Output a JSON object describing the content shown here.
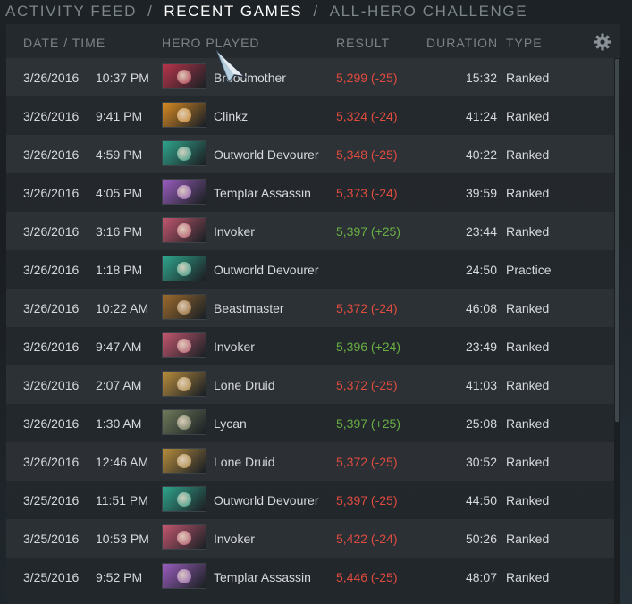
{
  "tabs": [
    {
      "label": "ACTIVITY FEED",
      "active": false
    },
    {
      "label": "RECENT GAMES",
      "active": true
    },
    {
      "label": "ALL-HERO CHALLENGE",
      "active": false
    }
  ],
  "tab_separator": "/",
  "columns": {
    "date_time": "DATE / TIME",
    "hero": "HERO PLAYED",
    "result": "RESULT",
    "duration": "DURATION",
    "type": "TYPE"
  },
  "settings_icon": "gear-icon",
  "colors": {
    "loss": "#e04b3f",
    "win": "#69b043",
    "text": "#d7dadc",
    "header": "#7c8387"
  },
  "games": [
    {
      "date": "3/26/2016",
      "time": "10:37 PM",
      "hero": "Broodmother",
      "hero_color": "#b8344b",
      "result": "5,299 (-25)",
      "outcome": "loss",
      "duration": "15:32",
      "type": "Ranked"
    },
    {
      "date": "3/26/2016",
      "time": "9:41 PM",
      "hero": "Clinkz",
      "hero_color": "#d88a22",
      "result": "5,324 (-24)",
      "outcome": "loss",
      "duration": "41:24",
      "type": "Ranked"
    },
    {
      "date": "3/26/2016",
      "time": "4:59 PM",
      "hero": "Outworld Devourer",
      "hero_color": "#2fa58c",
      "result": "5,348 (-25)",
      "outcome": "loss",
      "duration": "40:22",
      "type": "Ranked"
    },
    {
      "date": "3/26/2016",
      "time": "4:05 PM",
      "hero": "Templar Assassin",
      "hero_color": "#9a5dbf",
      "result": "5,373 (-24)",
      "outcome": "loss",
      "duration": "39:59",
      "type": "Ranked"
    },
    {
      "date": "3/26/2016",
      "time": "3:16 PM",
      "hero": "Invoker",
      "hero_color": "#c2566e",
      "result": "5,397 (+25)",
      "outcome": "win",
      "duration": "23:44",
      "type": "Ranked"
    },
    {
      "date": "3/26/2016",
      "time": "1:18 PM",
      "hero": "Outworld Devourer",
      "hero_color": "#2fa58c",
      "result": "",
      "outcome": "none",
      "duration": "24:50",
      "type": "Practice"
    },
    {
      "date": "3/26/2016",
      "time": "10:22 AM",
      "hero": "Beastmaster",
      "hero_color": "#9c6a2c",
      "result": "5,372 (-24)",
      "outcome": "loss",
      "duration": "46:08",
      "type": "Ranked"
    },
    {
      "date": "3/26/2016",
      "time": "9:47 AM",
      "hero": "Invoker",
      "hero_color": "#c2566e",
      "result": "5,396 (+24)",
      "outcome": "win",
      "duration": "23:49",
      "type": "Ranked"
    },
    {
      "date": "3/26/2016",
      "time": "2:07 AM",
      "hero": "Lone Druid",
      "hero_color": "#b88d3c",
      "result": "5,372 (-25)",
      "outcome": "loss",
      "duration": "41:03",
      "type": "Ranked"
    },
    {
      "date": "3/26/2016",
      "time": "1:30 AM",
      "hero": "Lycan",
      "hero_color": "#6e7a5a",
      "result": "5,397 (+25)",
      "outcome": "win",
      "duration": "25:08",
      "type": "Ranked"
    },
    {
      "date": "3/26/2016",
      "time": "12:46 AM",
      "hero": "Lone Druid",
      "hero_color": "#b88d3c",
      "result": "5,372 (-25)",
      "outcome": "loss",
      "duration": "30:52",
      "type": "Ranked"
    },
    {
      "date": "3/25/2016",
      "time": "11:51 PM",
      "hero": "Outworld Devourer",
      "hero_color": "#2fa58c",
      "result": "5,397 (-25)",
      "outcome": "loss",
      "duration": "44:50",
      "type": "Ranked"
    },
    {
      "date": "3/25/2016",
      "time": "10:53 PM",
      "hero": "Invoker",
      "hero_color": "#c2566e",
      "result": "5,422 (-24)",
      "outcome": "loss",
      "duration": "50:26",
      "type": "Ranked"
    },
    {
      "date": "3/25/2016",
      "time": "9:52 PM",
      "hero": "Templar Assassin",
      "hero_color": "#9a5dbf",
      "result": "5,446 (-25)",
      "outcome": "loss",
      "duration": "48:07",
      "type": "Ranked"
    }
  ]
}
